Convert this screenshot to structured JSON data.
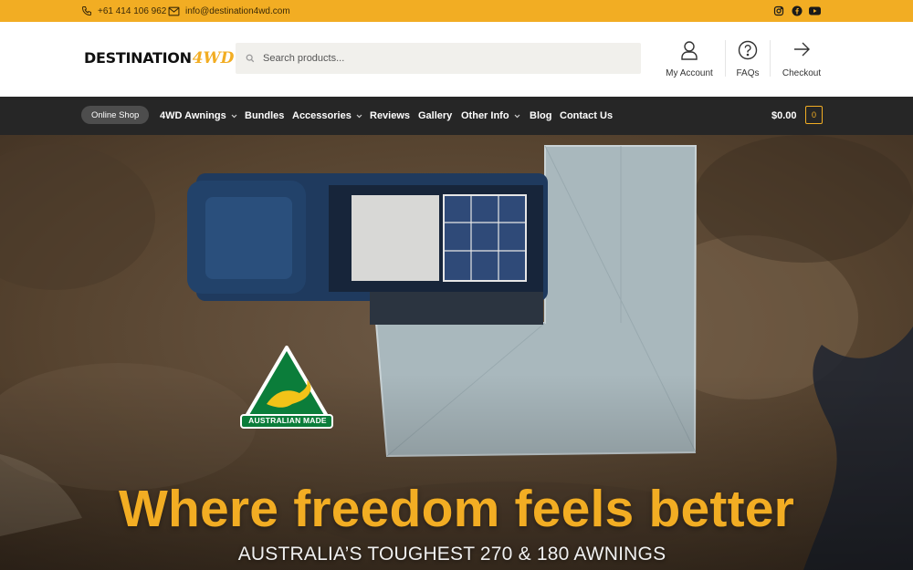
{
  "topbar": {
    "phone": "+61 414 106 962",
    "email": "info@destination4wd.com",
    "icons": [
      "phone-icon",
      "mail-icon",
      "instagram-icon",
      "facebook-icon",
      "youtube-icon"
    ]
  },
  "header": {
    "logo_main": "DESTINATION",
    "logo_accent": "4WD",
    "search_placeholder": "Search products...",
    "links": {
      "account": "My Account",
      "faqs": "FAQs",
      "checkout": "Checkout"
    }
  },
  "nav": {
    "pill": "Online Shop",
    "items": [
      {
        "label": "4WD Awnings",
        "dropdown": true
      },
      {
        "label": "Bundles",
        "dropdown": false
      },
      {
        "label": "Accessories",
        "dropdown": true
      },
      {
        "label": "Reviews",
        "dropdown": false
      },
      {
        "label": "Gallery",
        "dropdown": false
      },
      {
        "label": "Other Info",
        "dropdown": true
      },
      {
        "label": "Blog",
        "dropdown": false
      },
      {
        "label": "Contact Us",
        "dropdown": false
      }
    ],
    "cart_total": "$0.00",
    "cart_count": "0"
  },
  "hero": {
    "badge_text": "AUSTRALIAN MADE",
    "title": "Where freedom feels better",
    "subtitle": "AUSTRALIA’S TOUGHEST 270 & 180 AWNINGS"
  },
  "colors": {
    "accent": "#f2ad23",
    "nav_bg": "#262626"
  }
}
